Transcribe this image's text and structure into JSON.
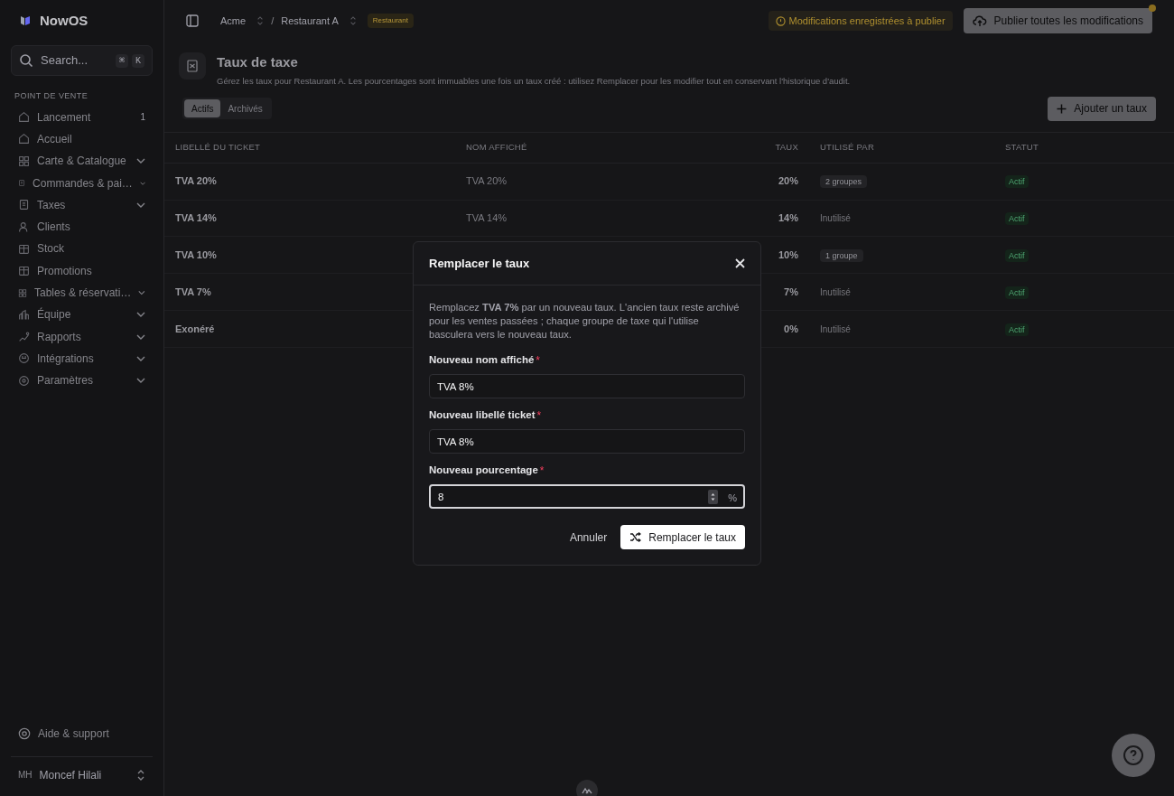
{
  "app": {
    "name": "NowOS"
  },
  "search": {
    "placeholder": "Search...",
    "shortcut": [
      "⌘",
      "K"
    ]
  },
  "sidebar": {
    "section": "POINT DE VENTE",
    "items": [
      {
        "label": "Lancement",
        "badge": "1",
        "expandable": false
      },
      {
        "label": "Accueil",
        "expandable": false
      },
      {
        "label": "Carte & Catalogue",
        "expandable": true
      },
      {
        "label": "Commandes & pai…",
        "expandable": true
      },
      {
        "label": "Taxes",
        "expandable": true
      },
      {
        "label": "Clients",
        "expandable": false
      },
      {
        "label": "Stock",
        "expandable": false
      },
      {
        "label": "Promotions",
        "expandable": false
      },
      {
        "label": "Tables & réservati…",
        "expandable": true
      },
      {
        "label": "Équipe",
        "expandable": true
      },
      {
        "label": "Rapports",
        "expandable": true
      },
      {
        "label": "Intégrations",
        "expandable": true
      },
      {
        "label": "Paramètres",
        "expandable": true
      }
    ],
    "help": "Aide & support",
    "user": {
      "initials": "MH",
      "name": "Moncef Hilali"
    }
  },
  "breadcrumb": [
    {
      "label": "Acme"
    },
    {
      "label": "Restaurant A"
    }
  ],
  "breadcrumb_separator": "/",
  "location_tag": "Restaurant",
  "pending_notice": "Modifications enregistrées à publier",
  "publish_button": "Publier toutes les modifications",
  "page": {
    "title": "Taux de taxe",
    "subtitle": "Gérez les taux pour Restaurant A. Les pourcentages sont immuables une fois un taux créé : utilisez Remplacer pour les modifier tout en conservant l'historique d'audit."
  },
  "tabs": [
    {
      "label": "Actifs",
      "selected": true
    },
    {
      "label": "Archivés",
      "selected": false
    }
  ],
  "add_button": "Ajouter un taux",
  "table": {
    "columns": [
      "LIBELLÉ DU TICKET",
      "NOM AFFICHÉ",
      "TAUX",
      "UTILISÉ PAR",
      "STATUT"
    ],
    "rows": [
      {
        "ticket_label": "TVA 20%",
        "display_name": "TVA 20%",
        "rate": "20%",
        "used_by": {
          "kind": "badge",
          "text": "2 groupes"
        },
        "status": "Actif"
      },
      {
        "ticket_label": "TVA 14%",
        "display_name": "TVA 14%",
        "rate": "14%",
        "used_by": {
          "kind": "plain",
          "text": "Inutilisé"
        },
        "status": "Actif"
      },
      {
        "ticket_label": "TVA 10%",
        "rate": "10%",
        "used_by": {
          "kind": "badge",
          "text": "1 groupe"
        },
        "status": "Actif"
      },
      {
        "ticket_label": "TVA 7%",
        "rate": "7%",
        "used_by": {
          "kind": "plain",
          "text": "Inutilisé"
        },
        "status": "Actif"
      },
      {
        "ticket_label": "Exonéré",
        "rate": "0%",
        "used_by": {
          "kind": "plain",
          "text": "Inutilisé"
        },
        "status": "Actif"
      }
    ]
  },
  "dialog": {
    "title": "Remplacer le taux",
    "description": "Remplacez **TVA 7%** par un nouveau taux. L'ancien taux reste archivé pour les ventes passées ; chaque groupe de taxe qui l'utilise basculera vers le nouveau taux.",
    "fields": [
      {
        "label": "Nouveau nom affiché",
        "required_mark": "*",
        "value": "TVA 8%",
        "focused": false
      },
      {
        "label": "Nouveau libellé ticket",
        "required_mark": "*",
        "value": "TVA 8%",
        "focused": false
      },
      {
        "label": "Nouveau pourcentage",
        "required_mark": "*",
        "value": "8",
        "suffix": "%",
        "kind": "number",
        "focused": true
      }
    ],
    "cancel": "Annuler",
    "confirm": "Remplacer le taux"
  }
}
